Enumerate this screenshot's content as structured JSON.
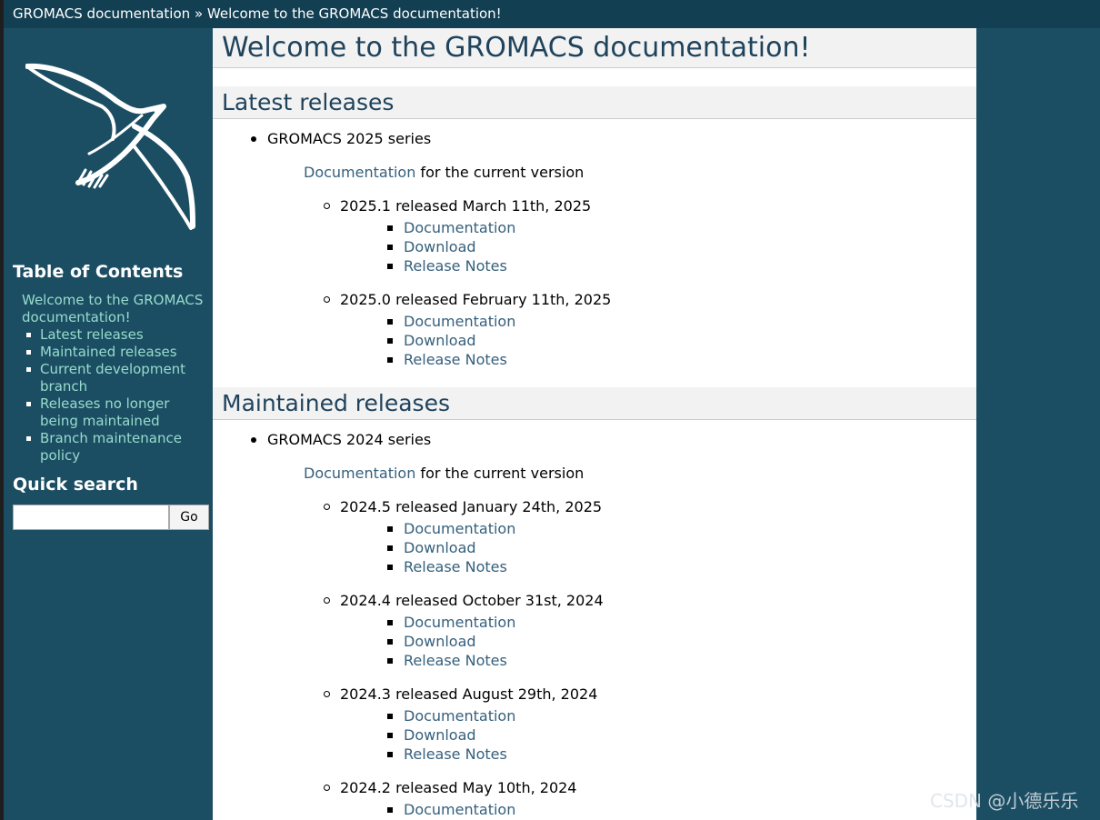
{
  "breadcrumb": {
    "home": "GROMACS documentation",
    "separator": "»",
    "current": "Welcome to the GROMACS documentation!"
  },
  "sidebar": {
    "toc_title": "Table of Contents",
    "toc_root": "Welcome to the GROMACS documentation!",
    "toc_items": [
      "Latest releases",
      "Maintained releases",
      "Current development branch",
      "Releases no longer being maintained",
      "Branch maintenance policy"
    ],
    "search_title": "Quick search",
    "search_value": "",
    "search_button": "Go"
  },
  "main": {
    "title": "Welcome to the GROMACS documentation!",
    "sections": [
      {
        "heading": "Latest releases",
        "series": "GROMACS 2025 series",
        "doc_link": "Documentation",
        "doc_suffix": " for the current version",
        "releases": [
          {
            "title": "2025.1 released March 11th, 2025",
            "links": [
              "Documentation",
              "Download",
              "Release Notes"
            ]
          },
          {
            "title": "2025.0 released February 11th, 2025",
            "links": [
              "Documentation",
              "Download",
              "Release Notes"
            ]
          }
        ]
      },
      {
        "heading": "Maintained releases",
        "series": "GROMACS 2024 series",
        "doc_link": "Documentation",
        "doc_suffix": " for the current version",
        "releases": [
          {
            "title": "2024.5 released January 24th, 2025",
            "links": [
              "Documentation",
              "Download",
              "Release Notes"
            ]
          },
          {
            "title": "2024.4 released October 31st, 2024",
            "links": [
              "Documentation",
              "Download",
              "Release Notes"
            ]
          },
          {
            "title": "2024.3 released August 29th, 2024",
            "links": [
              "Documentation",
              "Download",
              "Release Notes"
            ]
          },
          {
            "title": "2024.2 released May 10th, 2024",
            "links": [
              "Documentation"
            ]
          }
        ]
      }
    ]
  },
  "watermark": "CSDN @小德乐乐",
  "colors": {
    "sidebar_bg": "#1c4e63",
    "topbar_bg": "#133f52",
    "sidebar_link": "#98dbcc",
    "content_link": "#355f7c",
    "heading": "#20435c",
    "heading_bg": "#f2f2f2"
  }
}
